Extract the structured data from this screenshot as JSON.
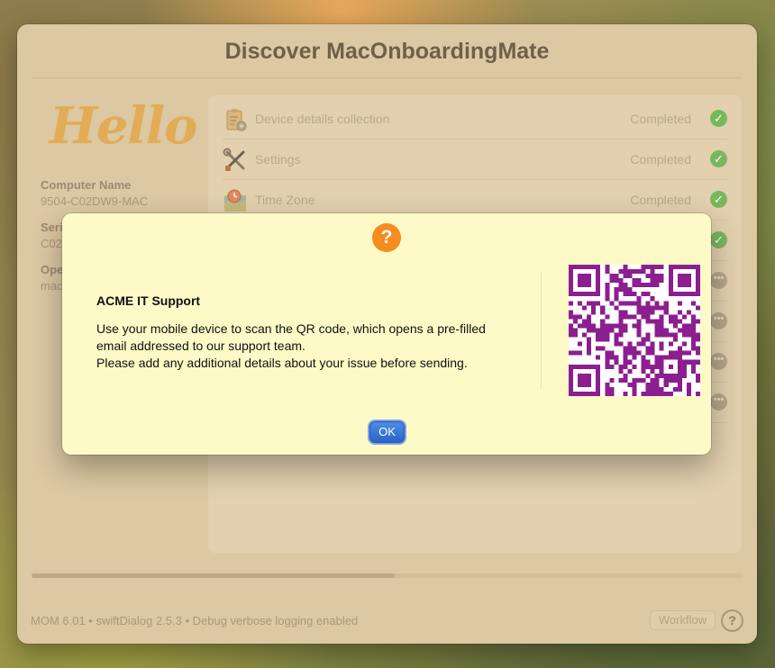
{
  "window": {
    "title": "Discover MacOnboardingMate"
  },
  "sidebar": {
    "greeting": "Hello",
    "computer_name_label": "Computer Name",
    "computer_name_value": "9504-C02DW9-MAC",
    "serial_label_partial": "Seri",
    "serial_value_partial": "C02",
    "os_label_partial": "Ope",
    "os_value_partial": "mac"
  },
  "steps": [
    {
      "label": "Device details collection",
      "status": "Completed",
      "icon": "clipboard-gear-icon",
      "state": "done"
    },
    {
      "label": "Settings",
      "status": "Completed",
      "icon": "wrench-screwdriver-icon",
      "state": "done"
    },
    {
      "label": "Time Zone",
      "status": "Completed",
      "icon": "map-clock-icon",
      "state": "done"
    },
    {
      "label": "",
      "status": "",
      "state": "done"
    },
    {
      "label": "",
      "status": "",
      "state": "pending"
    },
    {
      "label": "",
      "status": "",
      "state": "pending"
    },
    {
      "label": "",
      "status": "",
      "state": "pending"
    },
    {
      "label": "",
      "status": "",
      "state": "pending"
    }
  ],
  "progress": {
    "fraction": 0.51
  },
  "footer": {
    "info": "MOM 6.01 • swiftDialog 2.5.3 • Debug verbose logging enabled",
    "workflow_label": "Workflow",
    "help_label": "?"
  },
  "alert": {
    "icon_glyph": "?",
    "title": "ACME IT Support",
    "body_line1": "Use your mobile device to scan the QR code, which opens a pre-filled",
    "body_line2": "email addressed to our support team.",
    "body_line3": "Please add any additional details about your issue before sending.",
    "ok_label": "OK"
  },
  "colors": {
    "qr_purple": "#8b1f8f",
    "alert_bg": "#fefac8",
    "check_green": "#78b85c",
    "alert_icon_orange": "#f68b1f"
  }
}
